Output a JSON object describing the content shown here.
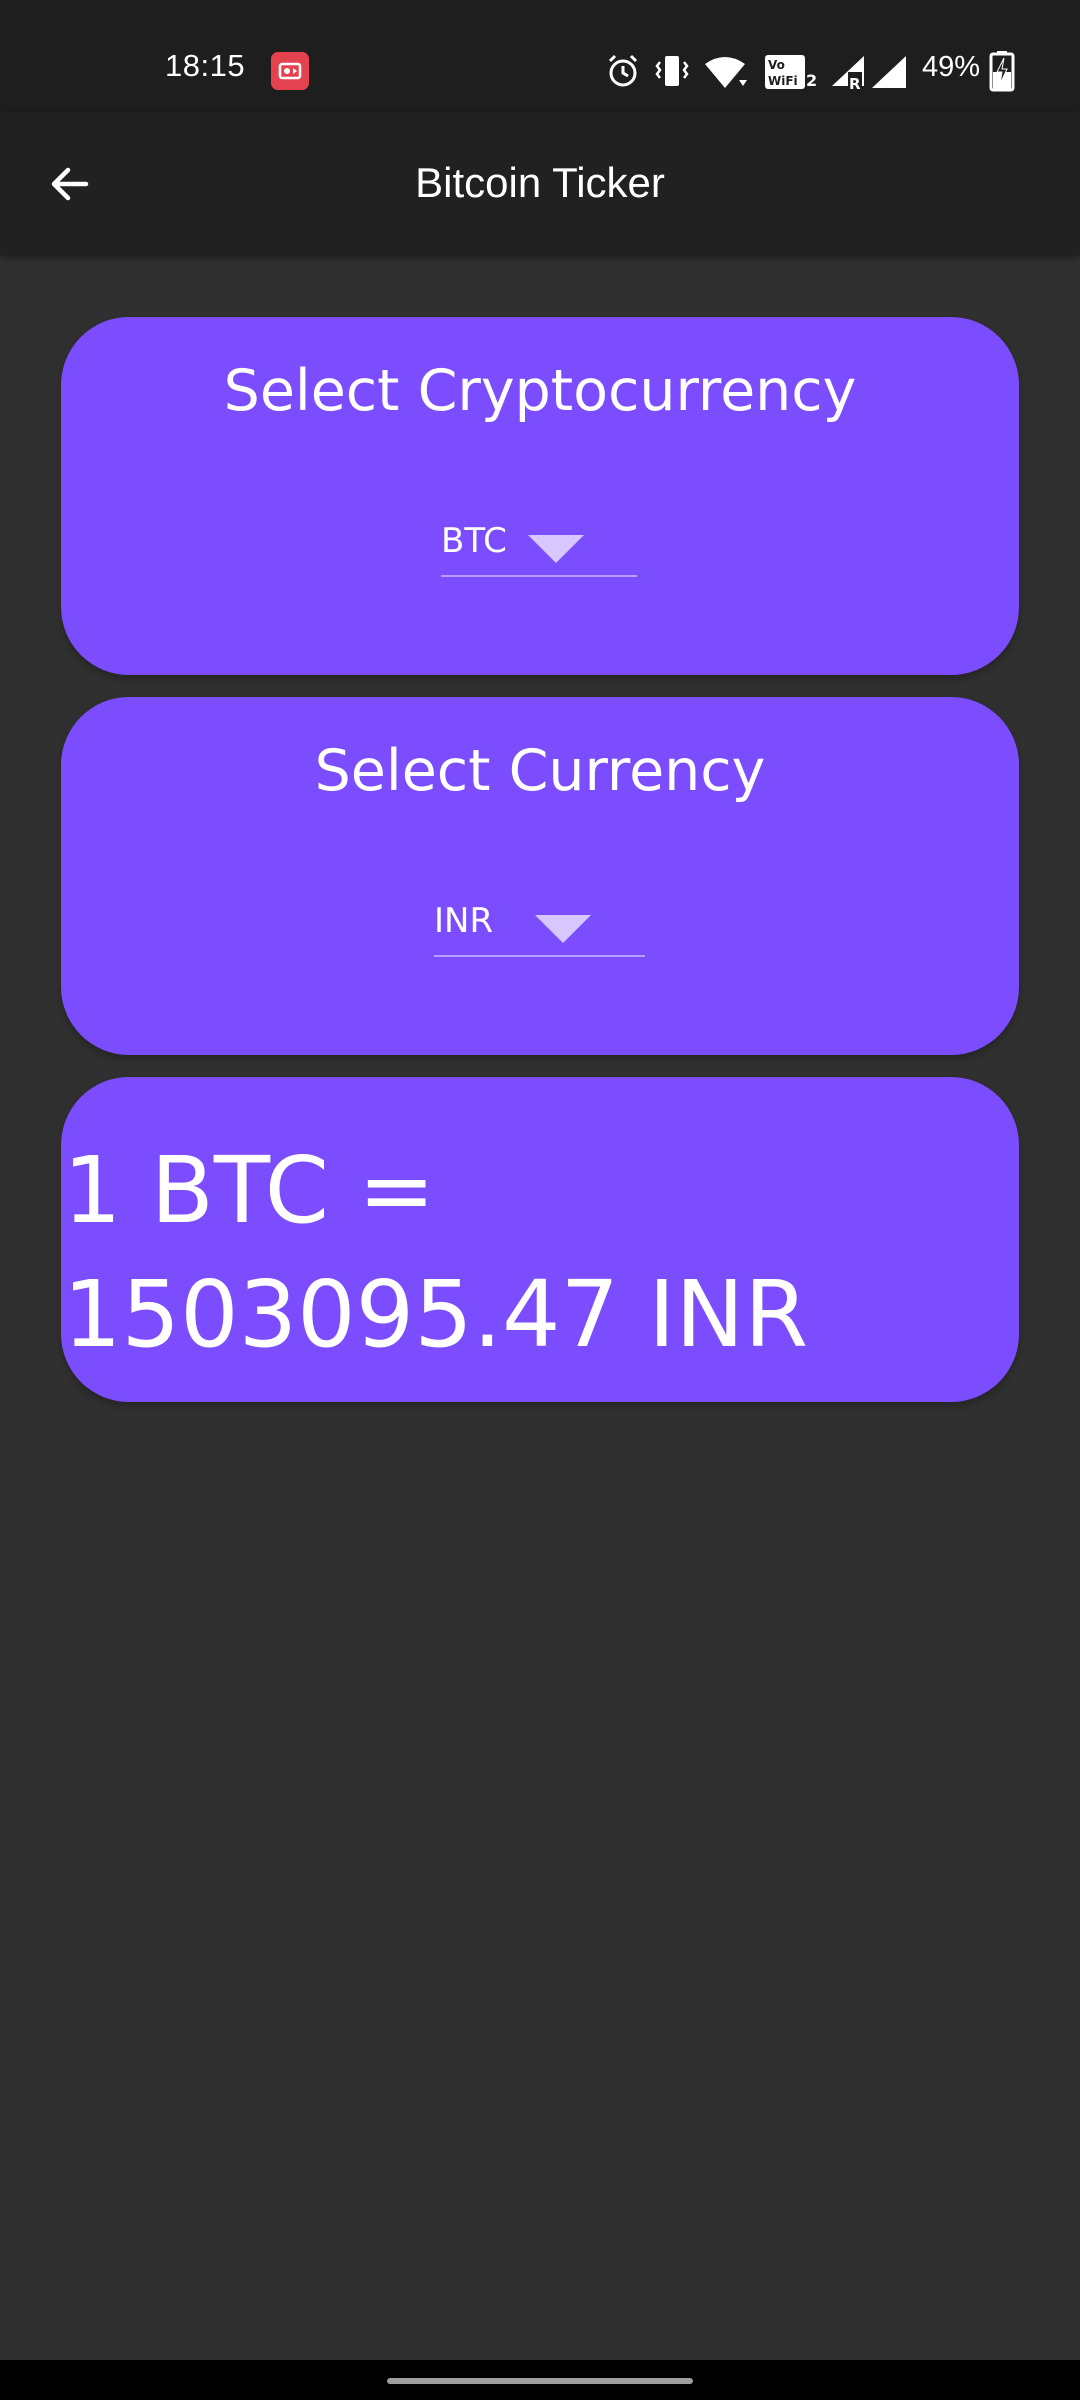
{
  "status_bar": {
    "time": "18:15",
    "battery": "49%",
    "icons": [
      "screen-record-icon",
      "alarm-icon",
      "vibrate-icon",
      "wifi-icon",
      "vowifi-icon",
      "signal-icon",
      "roaming-signal-icon",
      "battery-charging-icon"
    ],
    "wifi_label": "VoWiFi 2"
  },
  "app_bar": {
    "title": "Bitcoin Ticker",
    "back_icon": "arrow-left-icon"
  },
  "crypto_card": {
    "title": "Select Cryptocurrency",
    "selected": "BTC"
  },
  "currency_card": {
    "title": "Select Currency",
    "selected": "INR"
  },
  "rate_card": {
    "text": "1 BTC = 1503095.47 INR"
  },
  "colors": {
    "accent": "#7c4dff",
    "background": "#303030",
    "app_bar": "#212121",
    "status_bar": "#1e1e1e"
  }
}
